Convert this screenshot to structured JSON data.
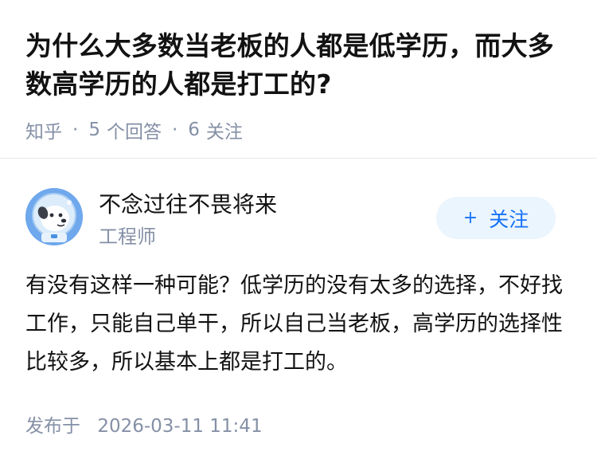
{
  "question": {
    "title": "为什么大多数当老板的人都是低学历，而大多数高学历的人都是打工的?",
    "source": "知乎",
    "separator": "·",
    "answer_count": "5",
    "answer_count_label": "个回答",
    "follower_count": "6",
    "follower_count_label": "关注"
  },
  "answer": {
    "author": {
      "name": "不念过往不畏将来",
      "title": "工程师",
      "avatar_icon": "astronaut-dog-avatar"
    },
    "follow_button": {
      "icon": "+",
      "label": "关注"
    },
    "content": "有没有这样一种可能？低学历的没有太多的选择，不好找工作，只能自己单干，所以自己当老板，高学历的选择性比较多，所以基本上都是打工的。",
    "publish_label": "发布于",
    "publish_time": "2026-03-11 11:41"
  },
  "colors": {
    "text_primary": "#121212",
    "text_secondary": "#8590a6",
    "accent": "#1772f6",
    "follow_bg": "#ebf5fd",
    "divider": "#ebebeb"
  }
}
